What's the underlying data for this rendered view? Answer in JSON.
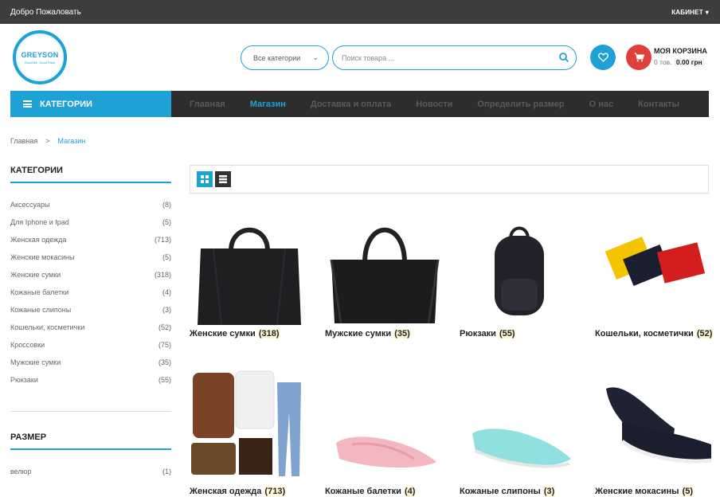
{
  "topbar": {
    "welcome": "Добро Пожаловать",
    "cabinet": "КАБИНЕТ"
  },
  "logo": {
    "name": "GREYSON",
    "tagline": "Good life. Good Price"
  },
  "search": {
    "category": "Все категории",
    "placeholder": "Поиск товара ..."
  },
  "cart": {
    "title": "МОЯ КОРЗИНА",
    "items": "0 тов.",
    "total": "0.00 грн"
  },
  "nav": {
    "categories_button": "КАТЕГОРИИ",
    "items": [
      {
        "label": "Главная",
        "active": false
      },
      {
        "label": "Магазин",
        "active": true
      },
      {
        "label": "Доставка и оплата",
        "active": false
      },
      {
        "label": "Новости",
        "active": false
      },
      {
        "label": "Определить размер",
        "active": false
      },
      {
        "label": "О нас",
        "active": false
      },
      {
        "label": "Контакты",
        "active": false
      }
    ]
  },
  "breadcrumb": {
    "home": "Главная",
    "sep": ">",
    "current": "Магазин"
  },
  "sidebar": {
    "categories_title": "КАТЕГОРИИ",
    "categories": [
      {
        "name": "Аксессуары",
        "count": "(8)"
      },
      {
        "name": "Для Iphone и Ipad",
        "count": "(5)"
      },
      {
        "name": "Женская одежда",
        "count": "(713)"
      },
      {
        "name": "Женские мокасины",
        "count": "(5)"
      },
      {
        "name": "Женские сумки",
        "count": "(318)"
      },
      {
        "name": "Кожаные балетки",
        "count": "(4)"
      },
      {
        "name": "Кожаные слипоны",
        "count": "(3)"
      },
      {
        "name": "Кошельки, косметички",
        "count": "(52)"
      },
      {
        "name": "Кроссовки",
        "count": "(75)"
      },
      {
        "name": "Мужские сумки",
        "count": "(35)"
      },
      {
        "name": "Рюкзаки",
        "count": "(55)"
      }
    ],
    "size_title": "РАЗМЕР",
    "sizes": [
      {
        "name": "велюр",
        "count": "(1)"
      }
    ]
  },
  "products": [
    {
      "name": "Женские сумки",
      "count": "(318)",
      "icon": "handbag-image"
    },
    {
      "name": "Мужские сумки",
      "count": "(35)",
      "icon": "duffel-bag-image"
    },
    {
      "name": "Рюкзаки",
      "count": "(55)",
      "icon": "backpack-image"
    },
    {
      "name": "Кошельки, косметички",
      "count": "(52)",
      "icon": "wallets-image"
    },
    {
      "name": "Женская одежда",
      "count": "(713)",
      "icon": "clothing-image"
    },
    {
      "name": "Кожаные балетки",
      "count": "(4)",
      "icon": "pink-flats-image"
    },
    {
      "name": "Кожаные слипоны",
      "count": "(3)",
      "icon": "mint-slipons-image"
    },
    {
      "name": "Женские мокасины",
      "count": "(5)",
      "icon": "black-slipons-image"
    }
  ],
  "colors": {
    "accent": "#1ea1d4",
    "cart": "#e0403c",
    "topbar": "#3d3d3d",
    "nav": "#2d2d2d"
  }
}
